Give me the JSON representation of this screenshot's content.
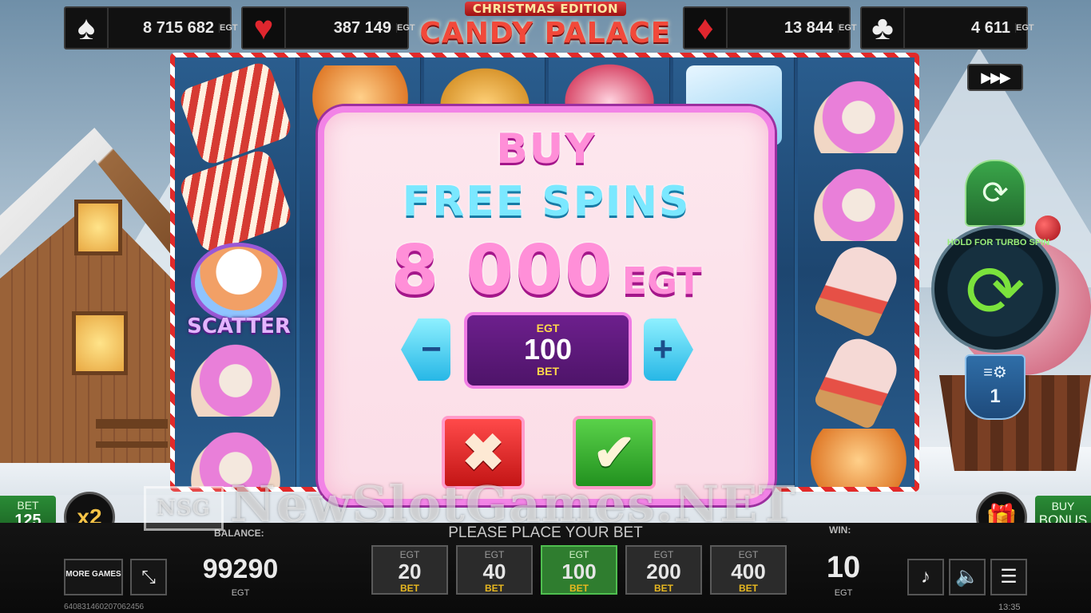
{
  "jackpots": [
    {
      "suit_icon": "spade-icon",
      "glyph": "♠",
      "amount": "8 715 682",
      "currency": "EGT"
    },
    {
      "suit_icon": "heart-icon",
      "glyph": "♥",
      "amount": "387 149",
      "currency": "EGT"
    },
    {
      "suit_icon": "diamond-icon",
      "glyph": "♦",
      "amount": "13 844",
      "currency": "EGT"
    },
    {
      "suit_icon": "club-icon",
      "glyph": "♣",
      "amount": "4 611",
      "currency": "EGT"
    }
  ],
  "logo": {
    "subtitle": "CHRISTMAS EDITION",
    "title": "CANDY PALACE"
  },
  "reels": {
    "scatter_label": "SCATTER"
  },
  "controls": {
    "turbo_glyph": "▶▶▶",
    "autoplay_glyph": "⟳",
    "spin_hint": "HOLD FOR TURBO SPIN",
    "spin_glyph": "⟳",
    "lines_glyph": "≡⚙",
    "lines_value": "1"
  },
  "modal": {
    "line1": "BUY",
    "line2": "FREE SPINS",
    "price_value": "8 000",
    "price_currency": "EGT",
    "minus_glyph": "−",
    "plus_glyph": "+",
    "bet_currency": "EGT",
    "bet_value": "100",
    "bet_label": "BET",
    "cancel_glyph": "✖",
    "confirm_glyph": "✔"
  },
  "side": {
    "bet_label": "BET",
    "bet_value": "125",
    "multiplier": "x2",
    "gift_glyph": "🎁",
    "buy_line1": "BUY",
    "buy_line2": "BONUS"
  },
  "watermark": {
    "badge": "NSG",
    "text": "NewSlotGames.NET"
  },
  "bottom": {
    "status": "PLEASE PLACE YOUR BET",
    "balance_label": "BALANCE:",
    "balance_value": "99290",
    "balance_currency": "EGT",
    "more_games": "MORE GAMES",
    "fullscreen_glyph": "⤡",
    "win_label": "WIN:",
    "win_value": "10",
    "win_currency": "EGT",
    "music_glyph": "♪",
    "sound_glyph": "🔈",
    "menu_glyph": "☰",
    "session_id": "640831460207062456",
    "time": "13:35"
  },
  "bet_chips": [
    {
      "currency": "EGT",
      "value": "20",
      "label": "BET",
      "active": false
    },
    {
      "currency": "EGT",
      "value": "40",
      "label": "BET",
      "active": false
    },
    {
      "currency": "EGT",
      "value": "100",
      "label": "BET",
      "active": true
    },
    {
      "currency": "EGT",
      "value": "200",
      "label": "BET",
      "active": false
    },
    {
      "currency": "EGT",
      "value": "400",
      "label": "BET",
      "active": false
    }
  ]
}
